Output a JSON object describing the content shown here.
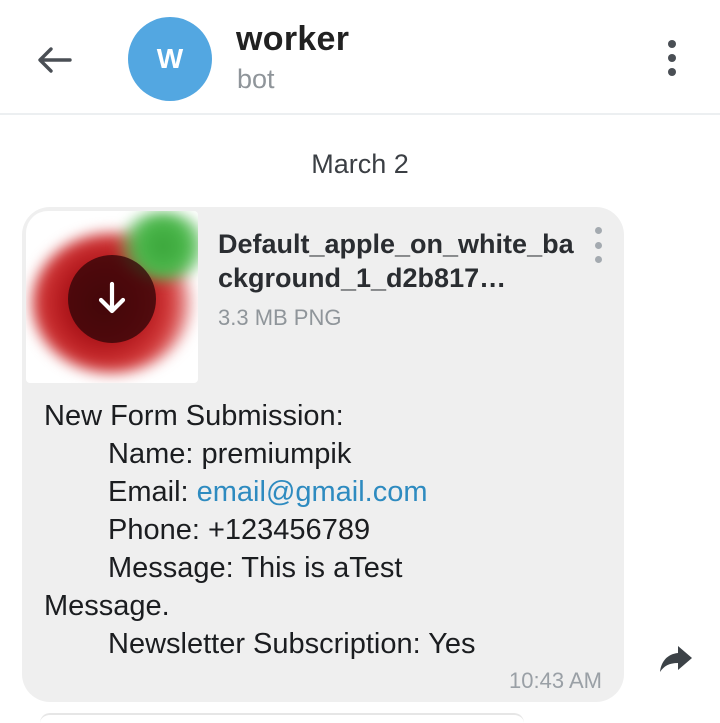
{
  "header": {
    "back_icon": "arrow-left-icon",
    "avatar_letter": "W",
    "avatar_color": "#53a7e1",
    "title": "worker",
    "subtitle": "bot",
    "menu_icon": "more-vertical-icon"
  },
  "chat": {
    "date_separator": "March 2",
    "message": {
      "file": {
        "name": "Default_apple_on_white_background_1_d2b817…",
        "name_visible": "Default_apple_on_white_b ackground_1_d2b817…",
        "meta": "3.3 MB PNG",
        "download_icon": "download-arrow-icon",
        "menu_icon": "more-vertical-icon"
      },
      "text": {
        "line1": "New Form Submission:",
        "name_label": "Name: ",
        "name_value": "premiumpik",
        "email_label": "Email: ",
        "email_value": "email@gmail.com",
        "phone_label": "Phone: ",
        "phone_value": "+123456789",
        "message_label": "Message: ",
        "message_value_part1": "This is aTest",
        "message_value_part2": "Message.",
        "newsletter_label": "Newsletter Subscription: ",
        "newsletter_value": "Yes"
      },
      "time": "10:43 AM",
      "forward_icon": "forward-share-icon"
    }
  },
  "colors": {
    "bubble_bg": "#efefef",
    "link": "#2e8bc0",
    "accent": "#53a7e1"
  }
}
